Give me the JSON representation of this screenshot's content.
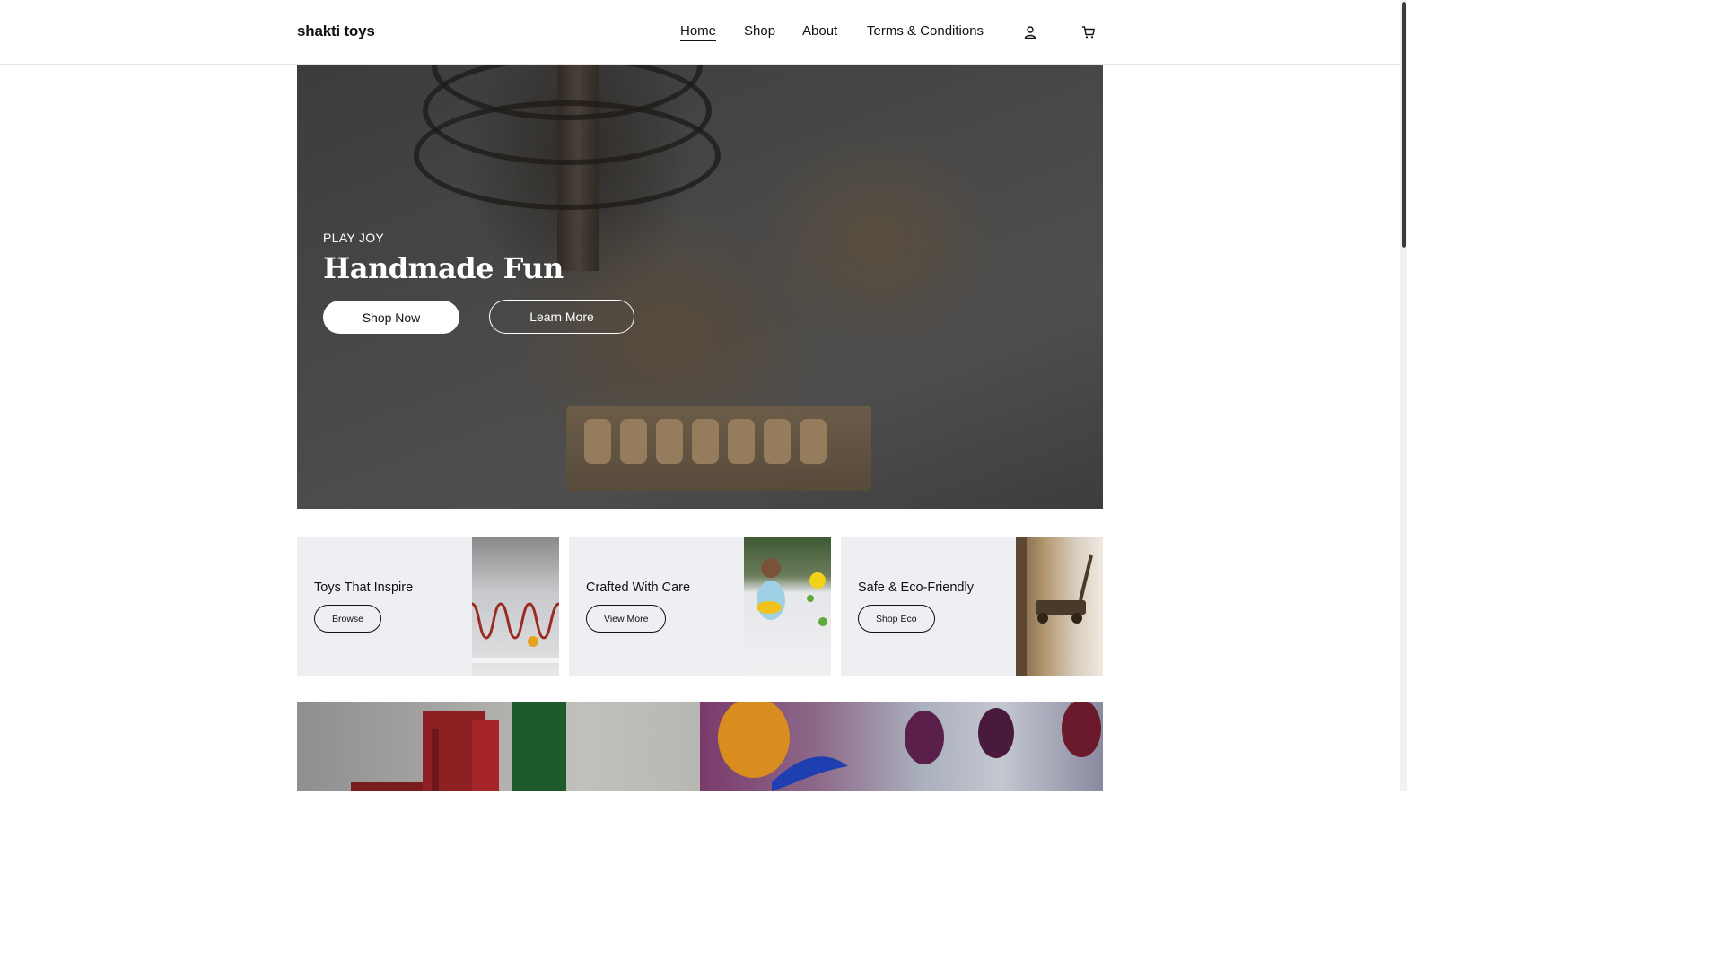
{
  "brand": {
    "logo": "shakti toys"
  },
  "nav": {
    "items": [
      {
        "label": "Home",
        "active": true
      },
      {
        "label": "Shop",
        "active": false
      },
      {
        "label": "About",
        "active": false
      },
      {
        "label": "Terms & Conditions",
        "active": false
      }
    ],
    "icons": [
      "user-icon",
      "cart-icon"
    ]
  },
  "hero": {
    "eyebrow": "PLAY JOY",
    "title": "Handmade Fun",
    "primary_button": "Shop Now",
    "secondary_button": "Learn More"
  },
  "features": [
    {
      "title": "Toys That Inspire",
      "button": "Browse"
    },
    {
      "title": "Crafted With Care",
      "button": "View More"
    },
    {
      "title": "Safe & Eco-Friendly",
      "button": "Shop Eco"
    }
  ],
  "colors": {
    "card_background": "#edeff3",
    "text": "#111111",
    "hero_text": "#ffffff"
  }
}
